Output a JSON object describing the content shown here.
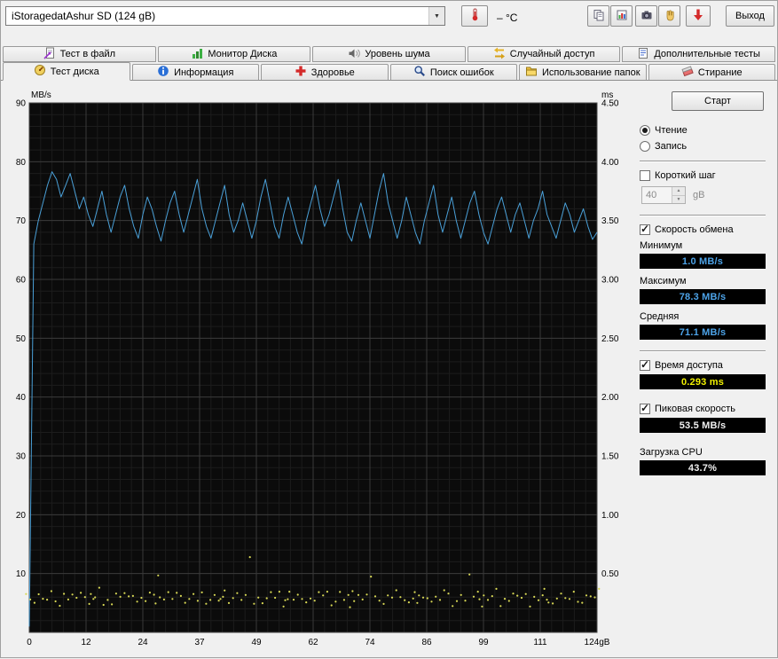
{
  "colors": {
    "read_speed": "#4aa0d8",
    "access_time": "#d8d855",
    "value_blue": "#4da3e8",
    "value_yellow": "#f0f000",
    "value_white": "#f0f0f0",
    "chart_bg": "#0b0b0b",
    "grid_major": "#3a3a3a",
    "grid_minor": "#1c1c1c"
  },
  "header": {
    "drive": "iStoragedatAshur SD (124 gB)",
    "temperature": "– °C",
    "exit_label": "Выход"
  },
  "icons": {
    "toolbar": [
      "thermometer-icon",
      "copy-text-icon",
      "copy-image-icon",
      "camera-icon",
      "hand-icon",
      "download-icon"
    ],
    "tabs_row1": [
      "file-benchmark-icon",
      "disk-monitor-icon",
      "noise-level-icon",
      "random-access-icon",
      "extra-tests-icon"
    ],
    "tabs_row2": [
      "disk-benchmark-icon",
      "info-icon",
      "health-icon",
      "error-scan-icon",
      "folder-usage-icon",
      "erase-icon"
    ]
  },
  "tabs_row1": [
    {
      "label": "Тест в файл"
    },
    {
      "label": "Монитор Диска"
    },
    {
      "label": "Уровень шума"
    },
    {
      "label": "Случайный доступ"
    },
    {
      "label": "Дополнительные  тесты"
    }
  ],
  "tabs_row2": [
    {
      "label": "Тест диска",
      "active": true
    },
    {
      "label": "Информация"
    },
    {
      "label": "Здоровье"
    },
    {
      "label": "Поиск ошибок"
    },
    {
      "label": "Использование папок"
    },
    {
      "label": "Стирание"
    }
  ],
  "panel": {
    "start_label": "Старт",
    "radio_read": "Чтение",
    "radio_write": "Запись",
    "short_stroke_label": "Короткий шаг",
    "short_stroke_value": "40",
    "short_stroke_unit": "gB",
    "transfer_rate_label": "Скорость обмена",
    "min_label": "Минимум",
    "min_value": "1.0 MB/s",
    "max_label": "Максимум",
    "max_value": "78.3 MB/s",
    "avg_label": "Средняя",
    "avg_value": "71.1 MB/s",
    "access_time_label": "Время доступа",
    "access_time_value": "0.293 ms",
    "burst_rate_label": "Пиковая скорость",
    "burst_rate_value": "53.5 MB/s",
    "cpu_label": "Загрузка CPU",
    "cpu_value": "43.7%"
  },
  "chart_data": {
    "type": "line",
    "title": "",
    "x_range": [
      0,
      124
    ],
    "x_unit": "gB",
    "x_ticks": [
      "0",
      "12",
      "24",
      "37",
      "49",
      "62",
      "74",
      "86",
      "99",
      "111",
      "124gB"
    ],
    "left_axis": {
      "label": "MB/s",
      "range": [
        0,
        90
      ],
      "ticks": [
        90,
        80,
        70,
        60,
        50,
        40,
        30,
        20,
        10
      ]
    },
    "right_axis": {
      "label": "ms",
      "range": [
        0,
        4.5
      ],
      "ticks": [
        "4.50",
        "4.00",
        "3.50",
        "3.00",
        "2.50",
        "2.00",
        "1.50",
        "1.00",
        "0.50"
      ]
    },
    "grid": {
      "on": true,
      "major_divisions_x": 10,
      "major_divisions_y": 9,
      "minor_per_major": 5
    },
    "series": [
      {
        "name": "read-speed-mbs",
        "kind": "line",
        "axis": "left",
        "values": [
          1,
          66,
          70,
          73,
          76,
          78.3,
          77,
          74,
          76,
          78,
          75,
          72,
          74,
          71,
          69,
          72,
          75,
          71,
          68,
          71,
          74,
          76,
          72,
          69,
          67,
          71,
          74,
          72,
          69,
          66.5,
          70,
          73,
          75,
          71,
          68,
          71,
          74,
          77,
          72,
          69,
          67,
          70,
          73,
          76,
          71,
          68,
          70,
          73,
          70,
          67,
          70,
          74,
          77,
          73,
          69,
          67,
          71,
          74,
          71,
          68,
          66,
          70,
          73,
          76,
          72,
          69,
          71,
          74,
          77,
          72,
          68,
          66.5,
          70,
          73,
          70,
          67,
          71,
          75,
          78,
          73,
          70,
          67,
          70,
          74,
          71,
          68,
          66,
          70,
          73,
          76,
          71,
          68,
          71,
          74,
          70,
          67,
          70,
          73,
          75,
          71,
          68,
          66,
          69,
          72,
          74,
          71,
          68,
          71,
          73,
          70,
          67,
          70,
          72,
          75,
          71,
          69,
          67,
          70,
          73,
          71,
          68,
          70,
          72,
          69,
          66.8,
          68
        ]
      },
      {
        "name": "access-time-ms",
        "kind": "scatter",
        "axis": "right",
        "values": [
          0.29,
          0.31,
          0.27,
          0.33,
          0.28,
          0.26,
          0.32,
          0.3,
          0.25,
          0.34,
          0.28,
          0.31,
          0.27,
          0.3,
          0.33,
          0.26,
          0.29,
          0.32,
          0.28,
          0.35,
          0.27,
          0.3,
          0.25,
          0.33,
          0.29,
          0.31,
          0.27,
          0.34,
          0.28,
          0.3,
          0.26,
          0.32,
          0.29,
          0.52,
          0.27,
          0.31,
          0.28,
          0.33,
          0.26,
          0.3,
          0.34,
          0.27,
          0.29,
          0.32,
          0.25,
          0.31,
          0.28,
          0.3,
          0.33,
          0.27,
          0.29,
          0.26,
          0.32,
          0.28,
          0.31,
          0.34,
          0.27,
          0.3,
          0.61,
          0.28,
          0.32,
          0.26,
          0.29,
          0.33,
          0.27,
          0.31,
          0.25,
          0.3,
          0.28,
          0.34,
          0.26,
          0.29,
          0.32,
          0.28,
          0.3,
          0.27,
          0.33,
          0.29,
          0.31,
          0.26,
          0.28,
          0.35,
          0.27,
          0.3,
          0.32,
          0.25,
          0.29,
          0.33,
          0.28,
          0.31,
          0.45,
          0.27,
          0.3,
          0.26,
          0.32,
          0.29,
          0.34,
          0.27,
          0.31,
          0.28,
          0.3,
          0.25,
          0.33,
          0.29,
          0.26,
          0.32,
          0.28,
          0.31,
          0.27,
          0.34,
          0.3,
          0.26,
          0.29,
          0.33,
          0.27,
          0.48,
          0.28,
          0.31,
          0.25,
          0.3,
          0.32,
          0.27,
          0.29,
          0.34,
          0.26,
          0.31,
          0.28,
          0.33,
          0.3,
          0.27,
          0.29,
          0.25,
          0.32,
          0.28,
          0.31,
          0.26,
          0.34,
          0.29,
          0.27,
          0.3,
          0.33,
          0.28,
          0.26,
          0.31,
          0.29,
          0.27,
          0.32,
          0.3,
          0.28,
          0.34
        ]
      }
    ],
    "stats": {
      "min": "1.0 MB/s",
      "max": "78.3 MB/s",
      "avg": "71.1 MB/s",
      "access_time": "0.293 ms",
      "burst": "53.5 MB/s",
      "cpu": "43.7%"
    }
  }
}
